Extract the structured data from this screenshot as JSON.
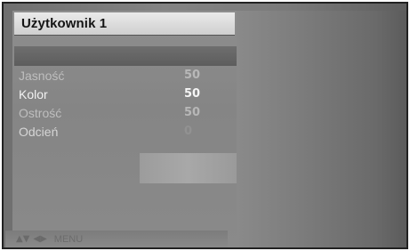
{
  "osd": {
    "title": "Użytkownik 1",
    "items": [
      {
        "label": "Jasność",
        "value": "50"
      },
      {
        "label": "Kolor",
        "value": "50"
      },
      {
        "label": "Ostrość",
        "value": "50"
      },
      {
        "label": "Odcień",
        "value": "0"
      }
    ],
    "footer": {
      "nav_icons": [
        "up-down-arrows-icon",
        "left-right-arrows-icon"
      ],
      "label": "MENU"
    }
  }
}
